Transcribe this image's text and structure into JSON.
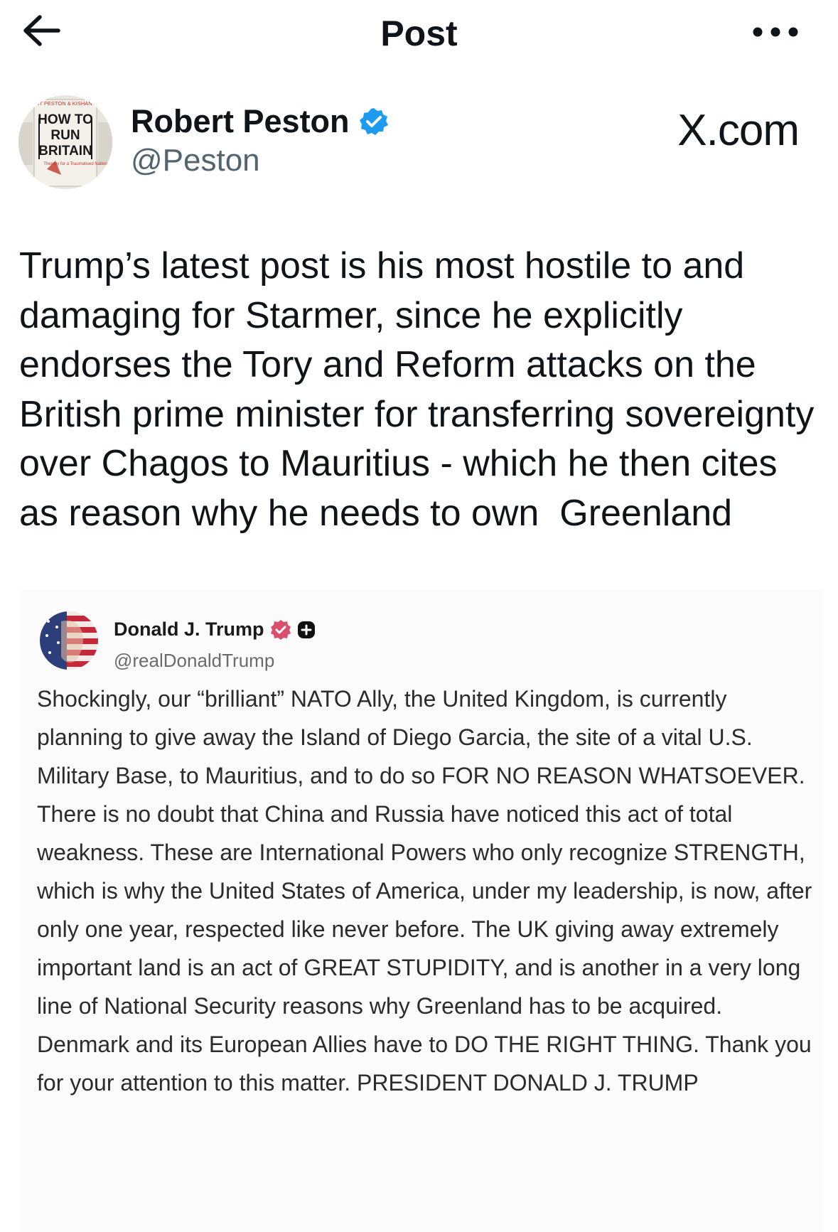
{
  "topbar": {
    "title": "Post",
    "back_icon": "arrow-left-icon",
    "more_icon": "more-horizontal-icon"
  },
  "author": {
    "name": "Robert Peston",
    "handle": "@Peston",
    "verified_color": "#1d9bf0",
    "avatar_book": {
      "authors": "ROBERT PESTON & KISHAN KORIA",
      "title_line1": "HOW TO",
      "title_line2": "RUN",
      "title_line3": "BRITAIN",
      "subtitle": "Therapy for a Traumatised Nation"
    }
  },
  "source": {
    "label": "X.com"
  },
  "post": {
    "text": "Trump’s latest post is his most hostile to and damaging for Starmer, since he explicitly endorses the Tory and Reform attacks on the British prime minister for transferring sovereignty over Chagos to Mauritius - which he then cites as reason why he needs to own  Greenland"
  },
  "embed": {
    "name": "Donald J. Trump",
    "handle": "@realDonaldTrump",
    "verified_color": "#d94f6c",
    "text": "Shockingly, our “brilliant” NATO Ally, the United Kingdom, is currently planning to give away the Island of Diego Garcia, the site of a vital U.S. Military Base, to Mauritius, and to do so FOR NO REASON WHATSOEVER. There is no doubt that China and Russia have noticed this act of total weakness. These are International Powers who only recognize STRENGTH, which is why the United States of America, under my leadership, is now, after only one year, respected like never before. The UK giving away extremely important land is an act of GREAT STUPIDITY, and is another in a very long line of National Security reasons why Greenland has to be acquired. Denmark and its European Allies have to DO THE RIGHT THING. Thank you for your attention to this matter. PRESIDENT DONALD J. TRUMP"
  }
}
